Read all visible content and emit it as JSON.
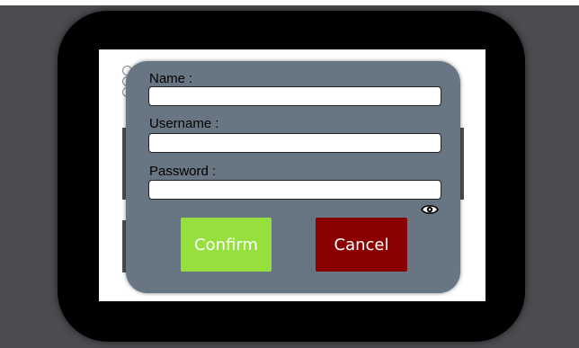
{
  "form": {
    "name_label": "Name :",
    "name_value": "",
    "username_label": "Username :",
    "username_value": "",
    "password_label": "Password :",
    "password_value": "",
    "password_toggle_icon": "eye-icon"
  },
  "actions": {
    "confirm_label": "Confirm",
    "cancel_label": "Cancel"
  },
  "colors": {
    "dialog_background": "#687582",
    "confirm_background": "#95e03d",
    "cancel_background": "#8b0000"
  }
}
